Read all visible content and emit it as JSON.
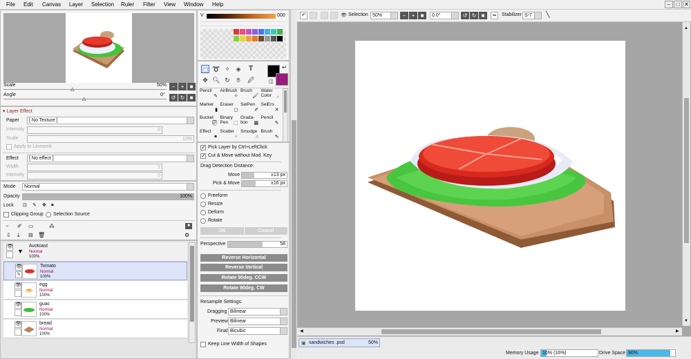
{
  "menu": [
    "File",
    "Edit",
    "Canvas",
    "Layer",
    "Selection",
    "Ruler",
    "Filter",
    "View",
    "Window",
    "Help"
  ],
  "navigator": {
    "scale_label": "Scale",
    "scale_value": "50%",
    "angle_label": "Angle",
    "angle_value": "0°"
  },
  "layer_effect": {
    "title": "Layer Effect",
    "paper_label": "Paper",
    "paper_value": "[ No Texture ]",
    "intensity_label": "Intensity",
    "intensity_value": "0",
    "scale_label": "Scale",
    "scale_value": "10%",
    "apply_linework": "Apply to Linework",
    "effect_label": "Effect",
    "effect_value": "[ No effect ]",
    "width_label": "Width",
    "width_value": "1",
    "intensity2_label": "Intensity",
    "intensity2_value": "0"
  },
  "layer_props": {
    "mode_label": "Mode",
    "mode_value": "Normal",
    "opacity_label": "Opacity",
    "opacity_value": "100%",
    "opacity_fraction": 1.0,
    "lock_label": "Lock",
    "clipping_group": "Clipping Group",
    "selection_source": "Selection Source"
  },
  "layers": [
    {
      "name": "Avotoast",
      "mode": "Normal",
      "opacity": "100%",
      "type": "folder"
    },
    {
      "name": "Tomato",
      "mode": "Normal",
      "opacity": "100%",
      "selected": true
    },
    {
      "name": "egg",
      "mode": "Normal",
      "opacity": "100%"
    },
    {
      "name": "guac",
      "mode": "Normal",
      "opacity": "100%"
    },
    {
      "name": "bread",
      "mode": "Normal",
      "opacity": "100%"
    }
  ],
  "color_panel": {
    "v_label": "V",
    "v_value": "000",
    "fg_color": "#000000",
    "bg_color": "#9b1a7e"
  },
  "palette_colors": [
    "#e23434",
    "#e8507a",
    "#c84fc8",
    "#8a5fe0",
    "#4a74e8",
    "#3fb4e6",
    "#39c9b2",
    "#3db35a",
    "#8bd13c",
    "#e6d63a",
    "#f0a23a",
    "#e07a2e",
    "#6b4a2c",
    "#9a9a9a",
    "#555555",
    "#000000"
  ],
  "brushes": [
    {
      "label": "Pencil"
    },
    {
      "label": "AirBrush"
    },
    {
      "label": "Brush"
    },
    {
      "label": "Water Color"
    },
    {
      "label": "Marker"
    },
    {
      "label": "Eraser"
    },
    {
      "label": "SelPen"
    },
    {
      "label": "SelErs"
    },
    {
      "label": "Bucket"
    },
    {
      "label": "Binary Pen"
    },
    {
      "label": "Grada- tion"
    },
    {
      "label": "Pencil"
    },
    {
      "label": "Effect"
    },
    {
      "label": "Scatter"
    },
    {
      "label": "Smudge"
    },
    {
      "label": "Brush"
    }
  ],
  "tool_options": {
    "pick_layer": "Pick Layer by Ctrl+LeftClick",
    "cut_move": "Cut & Move without Mod. Key",
    "drag_distance": "Drag Detection Distance:",
    "move_label": "Move",
    "move_value": "±13 px",
    "pick_move_label": "Pick & Move",
    "pick_move_value": "±16 px",
    "transform_modes": [
      "Freeform",
      "Resize",
      "Deform",
      "Rotate"
    ],
    "ok": "OK",
    "cancel": "Cancel",
    "perspective_label": "Perspective",
    "perspective_value": "58",
    "reverse_h": "Reverse Horizontal",
    "reverse_v": "Reverse Vertical",
    "rotate_ccw": "Rotate 90deg. CCW",
    "rotate_cw": "Rotate 90deg. CW",
    "resample_label": "Resample Settings:",
    "dragging_label": "Dragging",
    "dragging_value": "Bilinear",
    "preview_label": "Preview",
    "preview_value": "Bilinear",
    "final_label": "Final",
    "final_value": "Bicubic",
    "keep_line": "Keep Line Width of Shapes"
  },
  "toolbar": {
    "selection_label": "Selection",
    "zoom_value": "50%",
    "angle_value": "0.0°",
    "stabilizer_label": "Stabilizer",
    "stabilizer_value": "S-7"
  },
  "document_tab": {
    "name": "sandwiches .psd",
    "zoom": "50%"
  },
  "status": {
    "memory_label": "Memory Usage",
    "memory_value": "10% (16%)",
    "memory_fraction": 0.1,
    "drive_label": "Drive Space",
    "drive_value": "90%",
    "drive_fraction": 0.9
  }
}
